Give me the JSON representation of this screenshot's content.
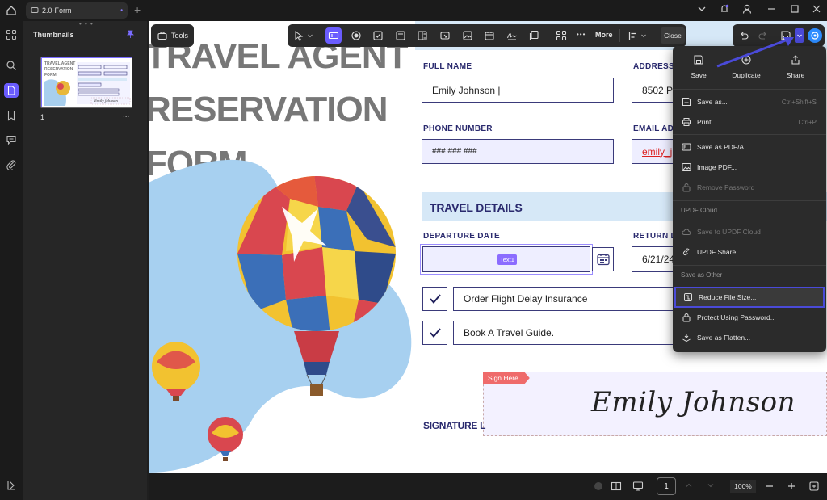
{
  "window": {
    "tab_title": "2.0-Form",
    "tab_close": "•",
    "new_tab": "+"
  },
  "thumbnails": {
    "title": "Thumbnails",
    "page_label": "1",
    "more": "..."
  },
  "toolbar": {
    "tools_label": "Tools",
    "more_label": "More",
    "close_label": "Close"
  },
  "document": {
    "title_lines": [
      "TRAVEL AGENT",
      "RESERVATION",
      "FORM"
    ],
    "full_name_label": "FULL NAME",
    "full_name_value": "Emily Johnson |",
    "address_label": "ADDRESS",
    "address_value": "8502 P",
    "phone_label": "PHONE NUMBER",
    "phone_value": "### ### ###",
    "email_label": "EMAIL AD",
    "email_value": "emily_j",
    "travel_details": "TRAVEL DETAILS",
    "departure_label": "DEPARTURE DATE",
    "departure_tag": "Text1",
    "return_label": "RETURN D",
    "return_value": "6/21/24",
    "option1": "Order Flight Delay Insurance",
    "option2": "Book A Travel Guide.",
    "sign_here": "Sign Here",
    "signature_label": "SIGNATURE L",
    "signature_text": "Emily Johnson"
  },
  "save_menu": {
    "top_actions": [
      {
        "label": "Save",
        "icon": "save-icon"
      },
      {
        "label": "Duplicate",
        "icon": "duplicate-icon"
      },
      {
        "label": "Share",
        "icon": "share-icon"
      }
    ],
    "save_as": "Save as...",
    "save_as_shortcut": "Ctrl+Shift+S",
    "print": "Print...",
    "print_shortcut": "Ctrl+P",
    "save_pdfa": "Save as PDF/A...",
    "image_pdf": "Image PDF...",
    "remove_password": "Remove Password",
    "cloud_section": "UPDF Cloud",
    "save_cloud": "Save to UPDF Cloud",
    "updf_share": "UPDF Share",
    "other_section": "Save as Other",
    "reduce_size": "Reduce File Size...",
    "protect_password": "Protect Using Password...",
    "save_flatten": "Save as Flatten..."
  },
  "bottombar": {
    "page_number": "1",
    "zoom": "100%"
  },
  "colors": {
    "accent": "#6a5cff",
    "highlight_border": "#4a4ad8",
    "doc_navy": "#2a2a6e",
    "field_lavender": "#eeeeff",
    "sign_red": "#ef6b6b"
  }
}
